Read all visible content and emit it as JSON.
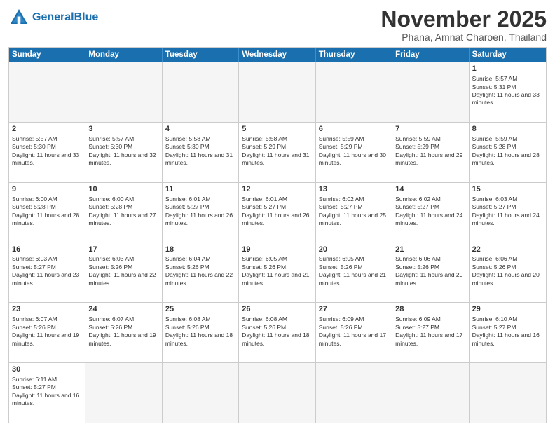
{
  "header": {
    "logo_general": "General",
    "logo_blue": "Blue",
    "month_title": "November 2025",
    "subtitle": "Phana, Amnat Charoen, Thailand"
  },
  "weekdays": [
    "Sunday",
    "Monday",
    "Tuesday",
    "Wednesday",
    "Thursday",
    "Friday",
    "Saturday"
  ],
  "weeks": [
    [
      {
        "day": "",
        "empty": true
      },
      {
        "day": "",
        "empty": true
      },
      {
        "day": "",
        "empty": true
      },
      {
        "day": "",
        "empty": true
      },
      {
        "day": "",
        "empty": true
      },
      {
        "day": "",
        "empty": true
      },
      {
        "day": "1",
        "sunrise": "Sunrise: 5:57 AM",
        "sunset": "Sunset: 5:31 PM",
        "daylight": "Daylight: 11 hours and 33 minutes."
      }
    ],
    [
      {
        "day": "2",
        "sunrise": "Sunrise: 5:57 AM",
        "sunset": "Sunset: 5:30 PM",
        "daylight": "Daylight: 11 hours and 33 minutes."
      },
      {
        "day": "3",
        "sunrise": "Sunrise: 5:57 AM",
        "sunset": "Sunset: 5:30 PM",
        "daylight": "Daylight: 11 hours and 32 minutes."
      },
      {
        "day": "4",
        "sunrise": "Sunrise: 5:58 AM",
        "sunset": "Sunset: 5:30 PM",
        "daylight": "Daylight: 11 hours and 31 minutes."
      },
      {
        "day": "5",
        "sunrise": "Sunrise: 5:58 AM",
        "sunset": "Sunset: 5:29 PM",
        "daylight": "Daylight: 11 hours and 31 minutes."
      },
      {
        "day": "6",
        "sunrise": "Sunrise: 5:59 AM",
        "sunset": "Sunset: 5:29 PM",
        "daylight": "Daylight: 11 hours and 30 minutes."
      },
      {
        "day": "7",
        "sunrise": "Sunrise: 5:59 AM",
        "sunset": "Sunset: 5:29 PM",
        "daylight": "Daylight: 11 hours and 29 minutes."
      },
      {
        "day": "8",
        "sunrise": "Sunrise: 5:59 AM",
        "sunset": "Sunset: 5:28 PM",
        "daylight": "Daylight: 11 hours and 28 minutes."
      }
    ],
    [
      {
        "day": "9",
        "sunrise": "Sunrise: 6:00 AM",
        "sunset": "Sunset: 5:28 PM",
        "daylight": "Daylight: 11 hours and 28 minutes."
      },
      {
        "day": "10",
        "sunrise": "Sunrise: 6:00 AM",
        "sunset": "Sunset: 5:28 PM",
        "daylight": "Daylight: 11 hours and 27 minutes."
      },
      {
        "day": "11",
        "sunrise": "Sunrise: 6:01 AM",
        "sunset": "Sunset: 5:27 PM",
        "daylight": "Daylight: 11 hours and 26 minutes."
      },
      {
        "day": "12",
        "sunrise": "Sunrise: 6:01 AM",
        "sunset": "Sunset: 5:27 PM",
        "daylight": "Daylight: 11 hours and 26 minutes."
      },
      {
        "day": "13",
        "sunrise": "Sunrise: 6:02 AM",
        "sunset": "Sunset: 5:27 PM",
        "daylight": "Daylight: 11 hours and 25 minutes."
      },
      {
        "day": "14",
        "sunrise": "Sunrise: 6:02 AM",
        "sunset": "Sunset: 5:27 PM",
        "daylight": "Daylight: 11 hours and 24 minutes."
      },
      {
        "day": "15",
        "sunrise": "Sunrise: 6:03 AM",
        "sunset": "Sunset: 5:27 PM",
        "daylight": "Daylight: 11 hours and 24 minutes."
      }
    ],
    [
      {
        "day": "16",
        "sunrise": "Sunrise: 6:03 AM",
        "sunset": "Sunset: 5:27 PM",
        "daylight": "Daylight: 11 hours and 23 minutes."
      },
      {
        "day": "17",
        "sunrise": "Sunrise: 6:03 AM",
        "sunset": "Sunset: 5:26 PM",
        "daylight": "Daylight: 11 hours and 22 minutes."
      },
      {
        "day": "18",
        "sunrise": "Sunrise: 6:04 AM",
        "sunset": "Sunset: 5:26 PM",
        "daylight": "Daylight: 11 hours and 22 minutes."
      },
      {
        "day": "19",
        "sunrise": "Sunrise: 6:05 AM",
        "sunset": "Sunset: 5:26 PM",
        "daylight": "Daylight: 11 hours and 21 minutes."
      },
      {
        "day": "20",
        "sunrise": "Sunrise: 6:05 AM",
        "sunset": "Sunset: 5:26 PM",
        "daylight": "Daylight: 11 hours and 21 minutes."
      },
      {
        "day": "21",
        "sunrise": "Sunrise: 6:06 AM",
        "sunset": "Sunset: 5:26 PM",
        "daylight": "Daylight: 11 hours and 20 minutes."
      },
      {
        "day": "22",
        "sunrise": "Sunrise: 6:06 AM",
        "sunset": "Sunset: 5:26 PM",
        "daylight": "Daylight: 11 hours and 20 minutes."
      }
    ],
    [
      {
        "day": "23",
        "sunrise": "Sunrise: 6:07 AM",
        "sunset": "Sunset: 5:26 PM",
        "daylight": "Daylight: 11 hours and 19 minutes."
      },
      {
        "day": "24",
        "sunrise": "Sunrise: 6:07 AM",
        "sunset": "Sunset: 5:26 PM",
        "daylight": "Daylight: 11 hours and 19 minutes."
      },
      {
        "day": "25",
        "sunrise": "Sunrise: 6:08 AM",
        "sunset": "Sunset: 5:26 PM",
        "daylight": "Daylight: 11 hours and 18 minutes."
      },
      {
        "day": "26",
        "sunrise": "Sunrise: 6:08 AM",
        "sunset": "Sunset: 5:26 PM",
        "daylight": "Daylight: 11 hours and 18 minutes."
      },
      {
        "day": "27",
        "sunrise": "Sunrise: 6:09 AM",
        "sunset": "Sunset: 5:26 PM",
        "daylight": "Daylight: 11 hours and 17 minutes."
      },
      {
        "day": "28",
        "sunrise": "Sunrise: 6:09 AM",
        "sunset": "Sunset: 5:27 PM",
        "daylight": "Daylight: 11 hours and 17 minutes."
      },
      {
        "day": "29",
        "sunrise": "Sunrise: 6:10 AM",
        "sunset": "Sunset: 5:27 PM",
        "daylight": "Daylight: 11 hours and 16 minutes."
      }
    ],
    [
      {
        "day": "30",
        "sunrise": "Sunrise: 6:11 AM",
        "sunset": "Sunset: 5:27 PM",
        "daylight": "Daylight: 11 hours and 16 minutes."
      },
      {
        "day": "",
        "empty": true
      },
      {
        "day": "",
        "empty": true
      },
      {
        "day": "",
        "empty": true
      },
      {
        "day": "",
        "empty": true
      },
      {
        "day": "",
        "empty": true
      },
      {
        "day": "",
        "empty": true
      }
    ]
  ]
}
